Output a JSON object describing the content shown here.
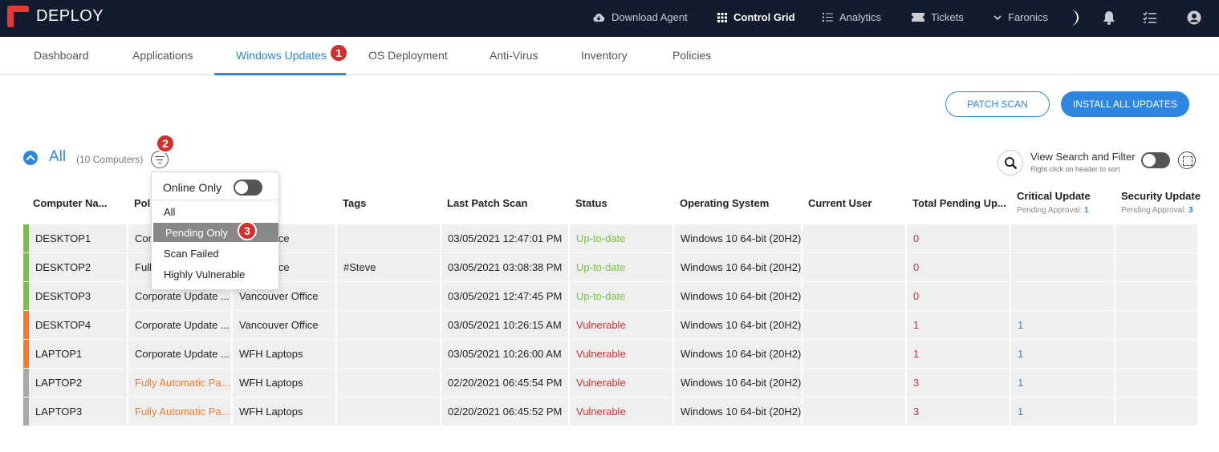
{
  "app": {
    "brand": "DEPLOY"
  },
  "topnav": {
    "download_agent": "Download Agent",
    "control_grid": "Control Grid",
    "analytics": "Analytics",
    "tickets": "Tickets",
    "org": "Faronics"
  },
  "tabs": [
    "Dashboard",
    "Applications",
    "Windows Updates",
    "OS Deployment",
    "Anti-Virus",
    "Inventory",
    "Policies"
  ],
  "active_tab": "Windows Updates",
  "markers": [
    "1",
    "2",
    "3"
  ],
  "actions": {
    "patch_scan": "PATCH SCAN",
    "install_all": "INSTALL ALL UPDATES"
  },
  "group": {
    "name": "All",
    "count": "(10 Computers)"
  },
  "search_filter": {
    "label": "View Search and Filter",
    "hint": "Right click on header to sort"
  },
  "filter_menu": {
    "online_only": "Online Only",
    "items": [
      "All",
      "Pending Only",
      "Scan Failed",
      "Highly Vulnerable"
    ],
    "selected": "Pending Only"
  },
  "columns": [
    "Computer Na...",
    "Poli",
    "",
    "Tags",
    "Last Patch Scan",
    "Status",
    "Operating System",
    "Current User",
    "Total Pending Up...",
    "Critical Update",
    "Security Update"
  ],
  "column_subs": {
    "critical": {
      "label": "Pending Approval:",
      "value": "1"
    },
    "security": {
      "label": "Pending Approval:",
      "value": "3"
    }
  },
  "colors": {
    "accent": "#2e86de",
    "ok": "#7cc242",
    "bad": "#d32f2f",
    "policy_orange": "#f07c2c",
    "bar_green": "#7cc242",
    "bar_orange": "#f07c2c",
    "bar_gray": "#a8a8a8"
  },
  "rows": [
    {
      "name": "DESKTOP1",
      "policy": "Corpo",
      "group": "uver Office",
      "tags": "",
      "scan": "03/05/2021 12:47:01 PM",
      "status": "Up-to-date",
      "os": "Windows 10 64-bit (20H2)",
      "user": "",
      "total": "0",
      "critical": "",
      "security": ""
    },
    {
      "name": "DESKTOP2",
      "policy": "Fully",
      "group": "uver Office",
      "tags": "#Steve",
      "scan": "03/05/2021 03:08:38 PM",
      "status": "Up-to-date",
      "os": "Windows 10 64-bit (20H2)",
      "user": "",
      "total": "0",
      "critical": "",
      "security": ""
    },
    {
      "name": "DESKTOP3",
      "policy": "Corporate Update ...",
      "group": "Vancouver Office",
      "tags": "",
      "scan": "03/05/2021 12:47:45 PM",
      "status": "Up-to-date",
      "os": "Windows 10 64-bit (20H2)",
      "user": "",
      "total": "0",
      "critical": "",
      "security": ""
    },
    {
      "name": "DESKTOP4",
      "policy": "Corporate Update ...",
      "group": "Vancouver Office",
      "tags": "",
      "scan": "03/05/2021 10:26:15 AM",
      "status": "Vulnerable",
      "os": "Windows 10 64-bit (20H2)",
      "user": "",
      "total": "1",
      "critical": "1",
      "security": ""
    },
    {
      "name": "LAPTOP1",
      "policy": "Corporate Update ...",
      "group": "WFH Laptops",
      "tags": "",
      "scan": "03/05/2021 10:26:00 AM",
      "status": "Vulnerable",
      "os": "Windows 10 64-bit (20H2)",
      "user": "",
      "total": "1",
      "critical": "1",
      "security": ""
    },
    {
      "name": "LAPTOP2",
      "policy": "Fully Automatic Pa...",
      "group": "WFH Laptops",
      "tags": "",
      "scan": "02/20/2021 06:45:54 PM",
      "status": "Vulnerable",
      "os": "Windows 10 64-bit (20H2)",
      "user": "",
      "total": "3",
      "critical": "1",
      "security": ""
    },
    {
      "name": "LAPTOP3",
      "policy": "Fully Automatic Pa...",
      "group": "WFH Laptops",
      "tags": "",
      "scan": "02/20/2021 06:45:52 PM",
      "status": "Vulnerable",
      "os": "Windows 10 64-bit (20H2)",
      "user": "",
      "total": "3",
      "critical": "1",
      "security": ""
    }
  ]
}
